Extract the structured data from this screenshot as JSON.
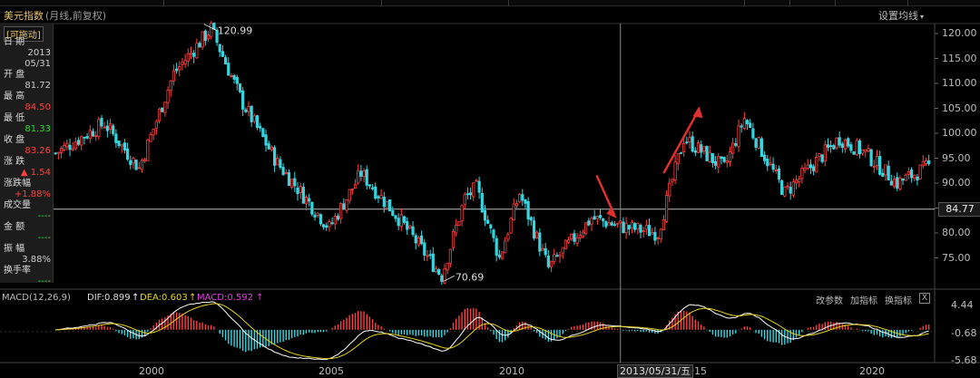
{
  "header": {
    "title": "美元指数",
    "subtitle": "(月线,前复权)",
    "settings_label": "设置均线",
    "colors": {
      "up": "#ff4040",
      "down": "#36d6e0",
      "dif": "#ffffff",
      "dea": "#e6d21a",
      "macd": "#e040e0",
      "gold": "#e6c36a"
    }
  },
  "side_panel": {
    "drag_label": "[可拖动]",
    "rows": [
      {
        "label": "日 期",
        "value": "2013\n05/31",
        "color": "#cccccc"
      },
      {
        "label": "开 盘",
        "value": "81.72",
        "color": "#cccccc"
      },
      {
        "label": "最 高",
        "value": "84.50",
        "color": "#ff4040"
      },
      {
        "label": "最 低",
        "value": "81.33",
        "color": "#33d633"
      },
      {
        "label": "收 盘",
        "value": "83.26",
        "color": "#ff4040"
      },
      {
        "label": "涨 跌",
        "value": "▲ 1.54",
        "color": "#ff4040"
      },
      {
        "label": "涨跌幅",
        "value": "+1.88%",
        "color": "#ff4040"
      },
      {
        "label": "成交量",
        "value": "----",
        "color": "#33d633"
      },
      {
        "label": "金 额",
        "value": "----",
        "color": "#33d633"
      },
      {
        "label": "振 幅",
        "value": "3.88%",
        "color": "#cccccc"
      },
      {
        "label": "换手率",
        "value": "----",
        "color": "#33d633"
      }
    ]
  },
  "price_axis": {
    "ticks": [
      "120.00",
      "115.00",
      "110.00",
      "105.00",
      "100.00",
      "95.00",
      "90.00",
      "85.00",
      "80.00",
      "75.00"
    ],
    "current": "84.77"
  },
  "macd": {
    "name": "MACD(12,26,9)",
    "dif_label": "DIF:0.899",
    "dea_label": "DEA:0.603",
    "macd_label": "MACD:0.592",
    "arrow": "↑",
    "tools": [
      "改参数",
      "加指标",
      "换指标"
    ],
    "close": "X",
    "axis": [
      "4.44",
      "-0.68",
      "-5.68"
    ]
  },
  "x_axis": {
    "years": [
      "2000",
      "2005",
      "2010",
      "2015",
      "2020"
    ],
    "crosshair_date": "2013/05/31/五"
  },
  "annotations": {
    "high": "120.99",
    "low": "70.69"
  },
  "chart_data": {
    "type": "candlestick",
    "title": "美元指数",
    "ylim": [
      70,
      122
    ],
    "x_range": [
      "1996-12",
      "2022-06"
    ],
    "current_price": 84.77,
    "series": [
      {
        "name": "美元指数",
        "x": [
          "1997-01",
          "1998-06",
          "1999-06",
          "2000-06",
          "2001-07",
          "2002-06",
          "2003-06",
          "2004-12",
          "2005-11",
          "2006-12",
          "2008-03",
          "2008-11",
          "2009-03",
          "2009-11",
          "2010-06",
          "2011-04",
          "2012-07",
          "2013-05",
          "2014-06",
          "2015-03",
          "2016-05",
          "2016-12",
          "2018-02",
          "2019-09",
          "2020-06",
          "2021-05",
          "2022-06"
        ],
        "y": [
          96,
          102,
          93,
          112,
          120.99,
          106,
          94,
          81,
          92,
          83,
          71.4,
          87,
          89,
          75,
          88,
          73,
          83,
          81.33,
          80,
          99,
          93,
          103,
          88,
          99,
          96,
          90,
          94
        ]
      }
    ],
    "macd": {
      "dif": 0.899,
      "dea": 0.603,
      "macd": 0.592,
      "ylim": [
        -5.68,
        4.44
      ]
    }
  }
}
